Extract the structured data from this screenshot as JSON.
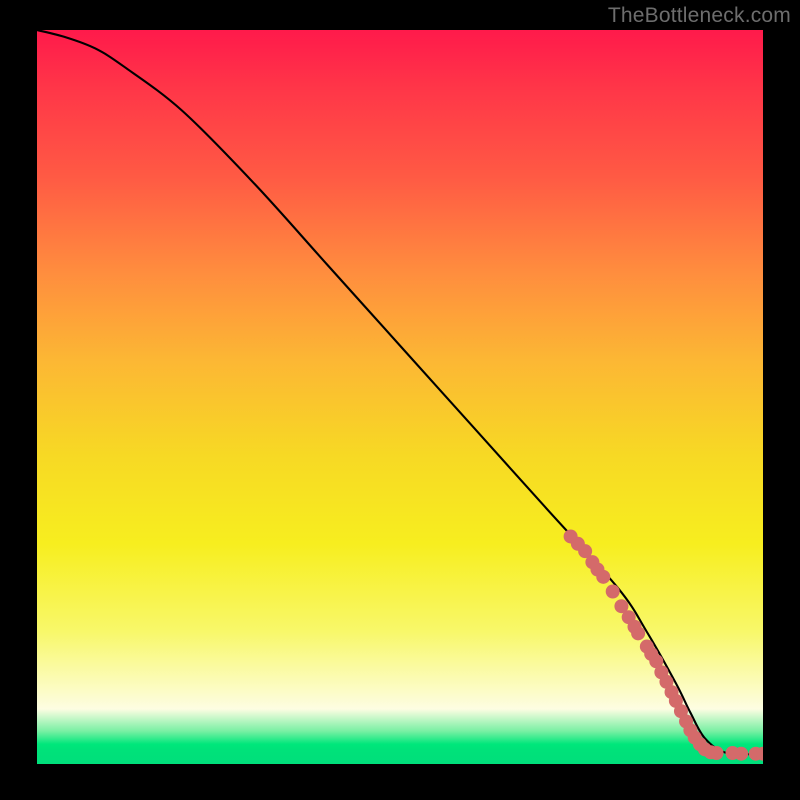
{
  "watermark": "TheBottleneck.com",
  "chart_data": {
    "type": "line",
    "title": "",
    "xlabel": "",
    "ylabel": "",
    "xlim": [
      0,
      100
    ],
    "ylim": [
      0,
      100
    ],
    "curve": {
      "name": "bottleneck-curve",
      "x": [
        0,
        4,
        8,
        12,
        20,
        30,
        40,
        50,
        60,
        70,
        80,
        84,
        88,
        90,
        92,
        95,
        100
      ],
      "y": [
        100,
        99,
        97.5,
        95,
        89,
        79,
        68,
        57,
        46,
        35,
        24,
        18,
        11,
        7,
        3.5,
        1.5,
        1.4
      ]
    },
    "highlighted_points": {
      "name": "marker-cluster",
      "color": "#d46a6a",
      "points": [
        {
          "x": 73.5,
          "y": 31.0
        },
        {
          "x": 74.5,
          "y": 30.0
        },
        {
          "x": 75.5,
          "y": 29.0
        },
        {
          "x": 76.5,
          "y": 27.5
        },
        {
          "x": 77.2,
          "y": 26.5
        },
        {
          "x": 78.0,
          "y": 25.5
        },
        {
          "x": 79.3,
          "y": 23.5
        },
        {
          "x": 80.5,
          "y": 21.5
        },
        {
          "x": 81.5,
          "y": 20.0
        },
        {
          "x": 82.3,
          "y": 18.7
        },
        {
          "x": 82.8,
          "y": 17.8
        },
        {
          "x": 84.0,
          "y": 16.0
        },
        {
          "x": 84.6,
          "y": 15.0
        },
        {
          "x": 85.3,
          "y": 14.0
        },
        {
          "x": 86.0,
          "y": 12.5
        },
        {
          "x": 86.7,
          "y": 11.2
        },
        {
          "x": 87.4,
          "y": 9.8
        },
        {
          "x": 88.0,
          "y": 8.6
        },
        {
          "x": 88.7,
          "y": 7.2
        },
        {
          "x": 89.4,
          "y": 5.8
        },
        {
          "x": 90.0,
          "y": 4.6
        },
        {
          "x": 90.6,
          "y": 3.6
        },
        {
          "x": 91.3,
          "y": 2.7
        },
        {
          "x": 92.0,
          "y": 2.0
        },
        {
          "x": 92.8,
          "y": 1.6
        },
        {
          "x": 93.6,
          "y": 1.5
        },
        {
          "x": 95.8,
          "y": 1.5
        },
        {
          "x": 97.0,
          "y": 1.4
        },
        {
          "x": 99.0,
          "y": 1.4
        },
        {
          "x": 100.0,
          "y": 1.4
        }
      ]
    }
  }
}
